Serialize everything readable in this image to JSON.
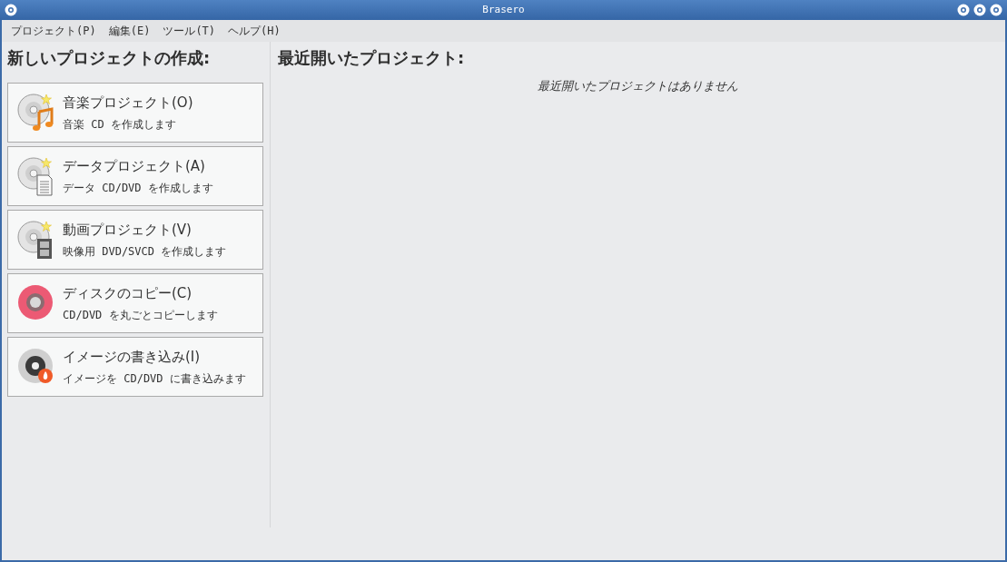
{
  "window": {
    "title": "Brasero"
  },
  "menu": [
    "プロジェクト(P)",
    "編集(E)",
    "ツール(T)",
    "ヘルプ(H)"
  ],
  "new_project": {
    "heading": "新しいプロジェクトの作成:",
    "items": [
      {
        "kind": "music",
        "title": "音楽プロジェクト(O)",
        "description": "音楽 CD を作成します"
      },
      {
        "kind": "data",
        "title": "データプロジェクト(A)",
        "description": "データ CD/DVD を作成します"
      },
      {
        "kind": "video",
        "title": "動画プロジェクト(V)",
        "description": "映像用 DVD/SVCD を作成します"
      },
      {
        "kind": "copy",
        "title": "ディスクのコピー(C)",
        "description": "CD/DVD を丸ごとコピーします"
      },
      {
        "kind": "burn",
        "title": "イメージの書き込み(I)",
        "description": "イメージを CD/DVD に書き込みます"
      }
    ]
  },
  "recent": {
    "heading": "最近開いたプロジェクト:",
    "empty_message": "最近開いたプロジェクトはありません"
  }
}
